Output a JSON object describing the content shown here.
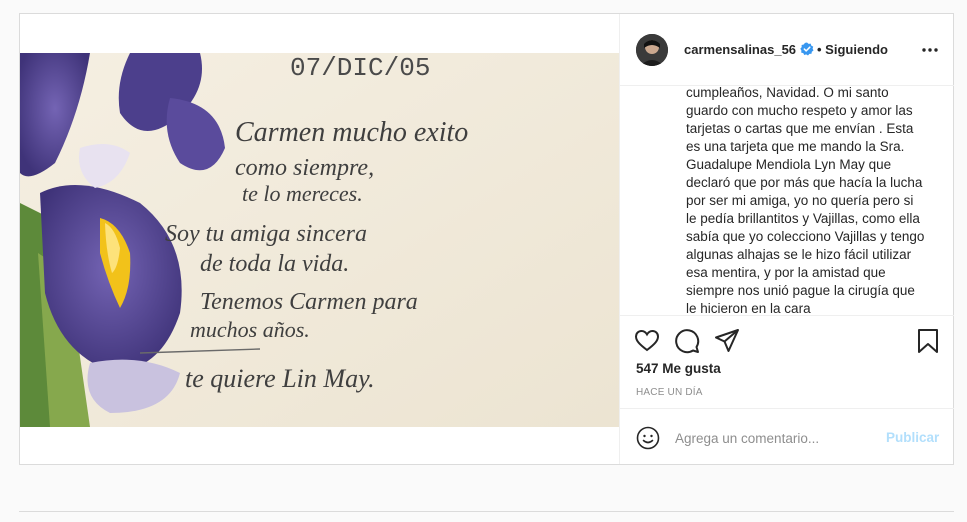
{
  "post": {
    "username": "carmensalinas_56",
    "follow_status": "• Siguiendo",
    "caption": "cumpleaños, Navidad. O mi santo guardo con mucho respeto y amor las tarjetas o cartas que me envían . Esta es una tarjeta que me mando la Sra. Guadalupe Mendiola Lyn May que declaró que por más que hacía la lucha por ser mi amiga, yo no quería pero si le pedía brillantitos y Vajillas, como ella sabía que yo colecciono Vajillas y tengo algunas alhajas se le hizo fácil utilizar esa mentira, y por la amistad que siempre nos unió pague la cirugía que le hicieron en la cara",
    "likes": "547 Me gusta",
    "time": "HACE UN DÍA"
  },
  "card": {
    "date": "07/DIC/05",
    "lines": [
      "Carmen mucho exito",
      "como siempre,",
      "te lo mereces.",
      "Soy tu amiga sincera",
      "de toda la vida.",
      "Tenemos Carmen para",
      "muchos años.",
      "te quiere   Lin May."
    ]
  },
  "comment": {
    "placeholder": "Agrega un comentario...",
    "publish_label": "Publicar"
  },
  "colors": {
    "link_disabled": "#b2dffc",
    "verified": "#3897f0",
    "iris": "#5b4b9a"
  }
}
